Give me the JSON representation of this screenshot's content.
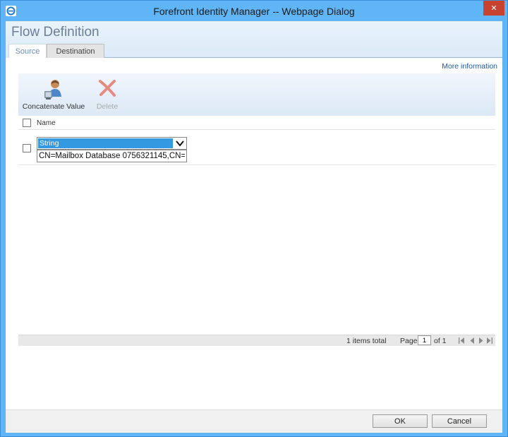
{
  "window": {
    "title": "Forefront Identity Manager -- Webpage Dialog",
    "close_glyph": "✕",
    "app_icon": "ie-icon",
    "colors": {
      "chrome": "#5fb5f5",
      "close": "#c7422f"
    }
  },
  "page": {
    "title": "Flow Definition",
    "more_info": "More information"
  },
  "tabs": [
    {
      "label": "Source",
      "selected": true
    },
    {
      "label": "Destination",
      "selected": false
    }
  ],
  "toolbar": {
    "concatenate_label": "Concatenate Value",
    "concatenate_icon": "concatenate-user-icon",
    "delete_label": "Delete",
    "delete_icon": "delete-x-icon",
    "delete_enabled": false
  },
  "grid": {
    "columns": [
      "Name"
    ],
    "rows": [
      {
        "type": "String",
        "value": "CN=Mailbox Database 0756321145,CN="
      }
    ]
  },
  "pager": {
    "total": "1 items total",
    "page_label": "Page",
    "current_page": "1",
    "of_label": "of 1"
  },
  "footer": {
    "ok": "OK",
    "cancel": "Cancel"
  }
}
